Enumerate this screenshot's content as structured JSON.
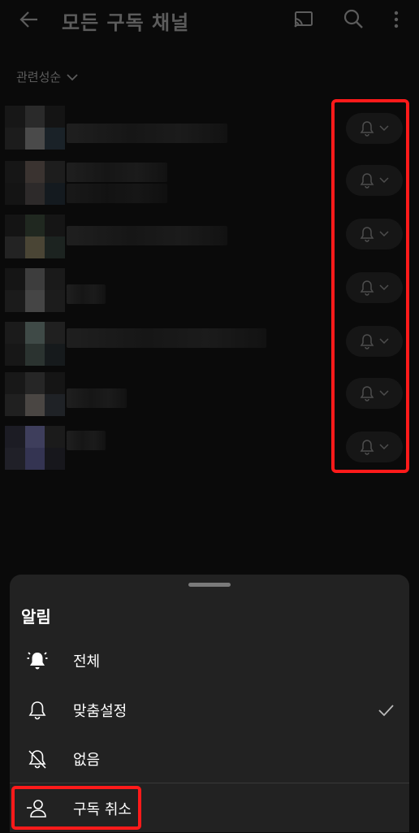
{
  "header": {
    "title": "모든 구독 채널"
  },
  "sort": {
    "label": "관련성순"
  },
  "channels": [
    {
      "bell": "bell-icon"
    },
    {
      "bell": "bell-icon"
    },
    {
      "bell": "bell-icon"
    },
    {
      "bell": "bell-icon"
    },
    {
      "bell": "bell-icon"
    },
    {
      "bell": "bell-icon"
    },
    {
      "bell": "bell-icon"
    }
  ],
  "sheet": {
    "title": "알림",
    "options": [
      {
        "label": "전체",
        "icon": "bell-ringing-icon"
      },
      {
        "label": "맞춤설정",
        "icon": "bell-icon",
        "selected": true
      },
      {
        "label": "없음",
        "icon": "bell-off-icon"
      }
    ],
    "unsubscribe": {
      "label": "구독 취소",
      "icon": "person-remove-icon"
    }
  },
  "colors": {
    "highlight": "#ff1a1a",
    "sheet_bg": "#222222",
    "page_bg": "#0a0a0a"
  }
}
